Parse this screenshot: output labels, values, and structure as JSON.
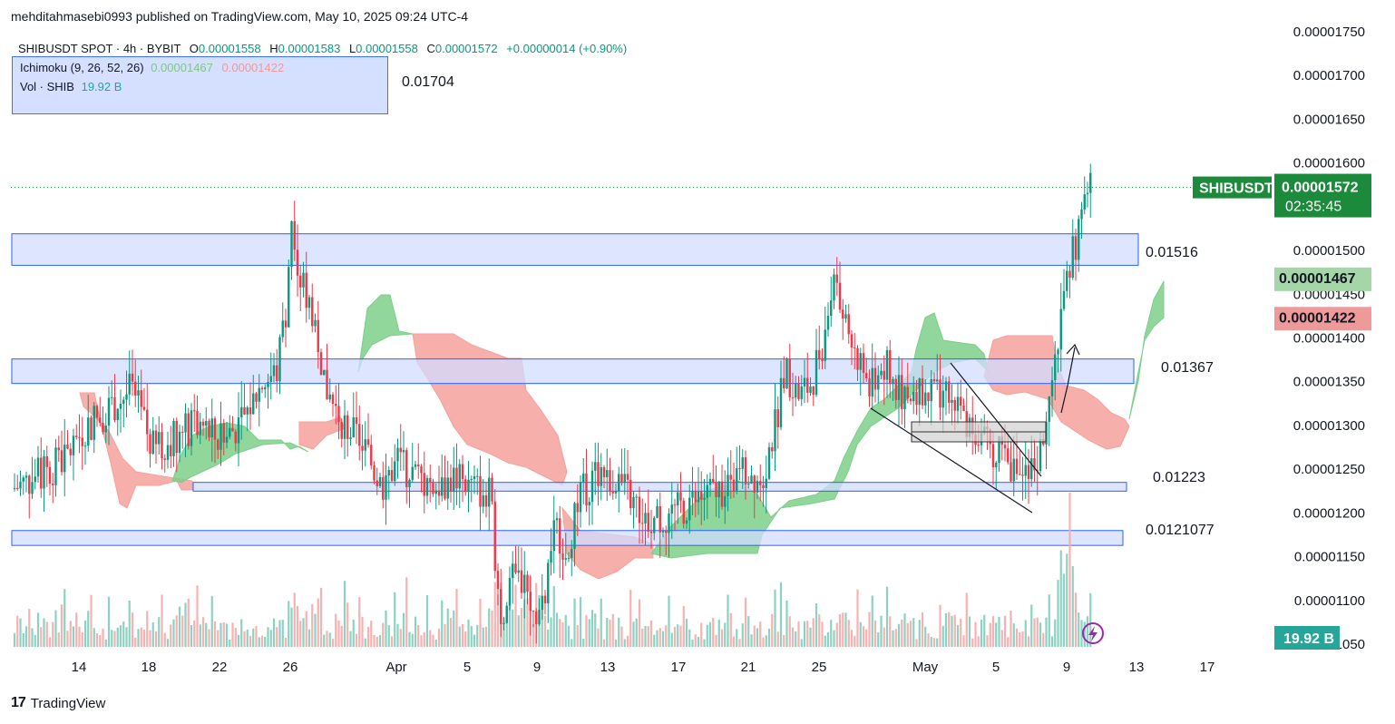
{
  "publisher": "mehditahmasebi0993 published on TradingView.com, May 10, 2025 09:24 UTC-4",
  "legend": {
    "symbol_line": "SHIBUSDT SPOT · 4h · BYBIT",
    "o_label": "O",
    "o_value": "0.00001558",
    "h_label": "H",
    "h_value": "0.00001583",
    "l_label": "L",
    "l_value": "0.00001558",
    "c_label": "C",
    "c_value": "0.00001572",
    "change": "+0.00000014 (+0.90%)",
    "ichimoku_label": "Ichimoku (9, 26, 52, 26)",
    "ichimoku_a": "0.00001467",
    "ichimoku_b": "0.00001422",
    "vol_label": "Vol · SHIB",
    "vol_value": "19.92 B"
  },
  "footer": {
    "brand": "TradingView",
    "brand_mark": "17"
  },
  "colors": {
    "up": "#089981",
    "down": "#f23645",
    "zone_fill": "#d1dcff",
    "zone_stroke": "#2962ff",
    "cloud_green": "#7ecf8a",
    "cloud_red": "#f5a19b",
    "price_badge": "#1b8a3a",
    "span_a_badge": "#a5d6a7",
    "span_b_badge": "#ef9a9a",
    "vol_badge": "#26a69a"
  },
  "chart_data": {
    "type": "candlestick",
    "symbol": "SHIBUSDT",
    "timeframe": "4h",
    "y_axis": {
      "ticks": [
        "0.00001750",
        "0.00001700",
        "0.00001650",
        "0.00001600",
        "0.00001550",
        "0.00001500",
        "0.00001450",
        "0.00001400",
        "0.00001350",
        "0.00001300",
        "0.00001250",
        "0.00001200",
        "0.00001150",
        "0.00001100",
        "0.00001050"
      ],
      "range": [
        1.045e-05,
        1.755e-05
      ]
    },
    "x_axis": {
      "ticks": [
        "14",
        "18",
        "22",
        "26",
        "Apr",
        "5",
        "9",
        "13",
        "17",
        "21",
        "25",
        "May",
        "5",
        "9",
        "13",
        "17"
      ]
    },
    "price_label": {
      "symbol": "SHIBUSDT",
      "value": "0.00001572",
      "countdown": "02:35:45",
      "value_num": 1.572e-05
    },
    "span_a_label": {
      "value": "0.00001467",
      "value_num": 1.467e-05
    },
    "span_b_label": {
      "value": "0.00001422",
      "value_num": 1.422e-05
    },
    "volume_label": {
      "value": "19.92 B"
    },
    "annotations": [
      {
        "text": "0.01704"
      },
      {
        "text": "0.01516"
      },
      {
        "text": "0.01367"
      },
      {
        "text": "0.01223"
      },
      {
        "text": "0.0121077"
      }
    ],
    "zones": [
      {
        "name": "resistance-zone-top",
        "low": 1.483e-05,
        "high": 1.519e-05
      },
      {
        "name": "zone-middle",
        "low": 1.348e-05,
        "high": 1.376e-05
      },
      {
        "name": "support-zone-1223",
        "low": 1.225e-05,
        "high": 1.235e-05
      },
      {
        "name": "support-zone-1210",
        "low": 1.163e-05,
        "high": 1.18e-05
      }
    ]
  }
}
